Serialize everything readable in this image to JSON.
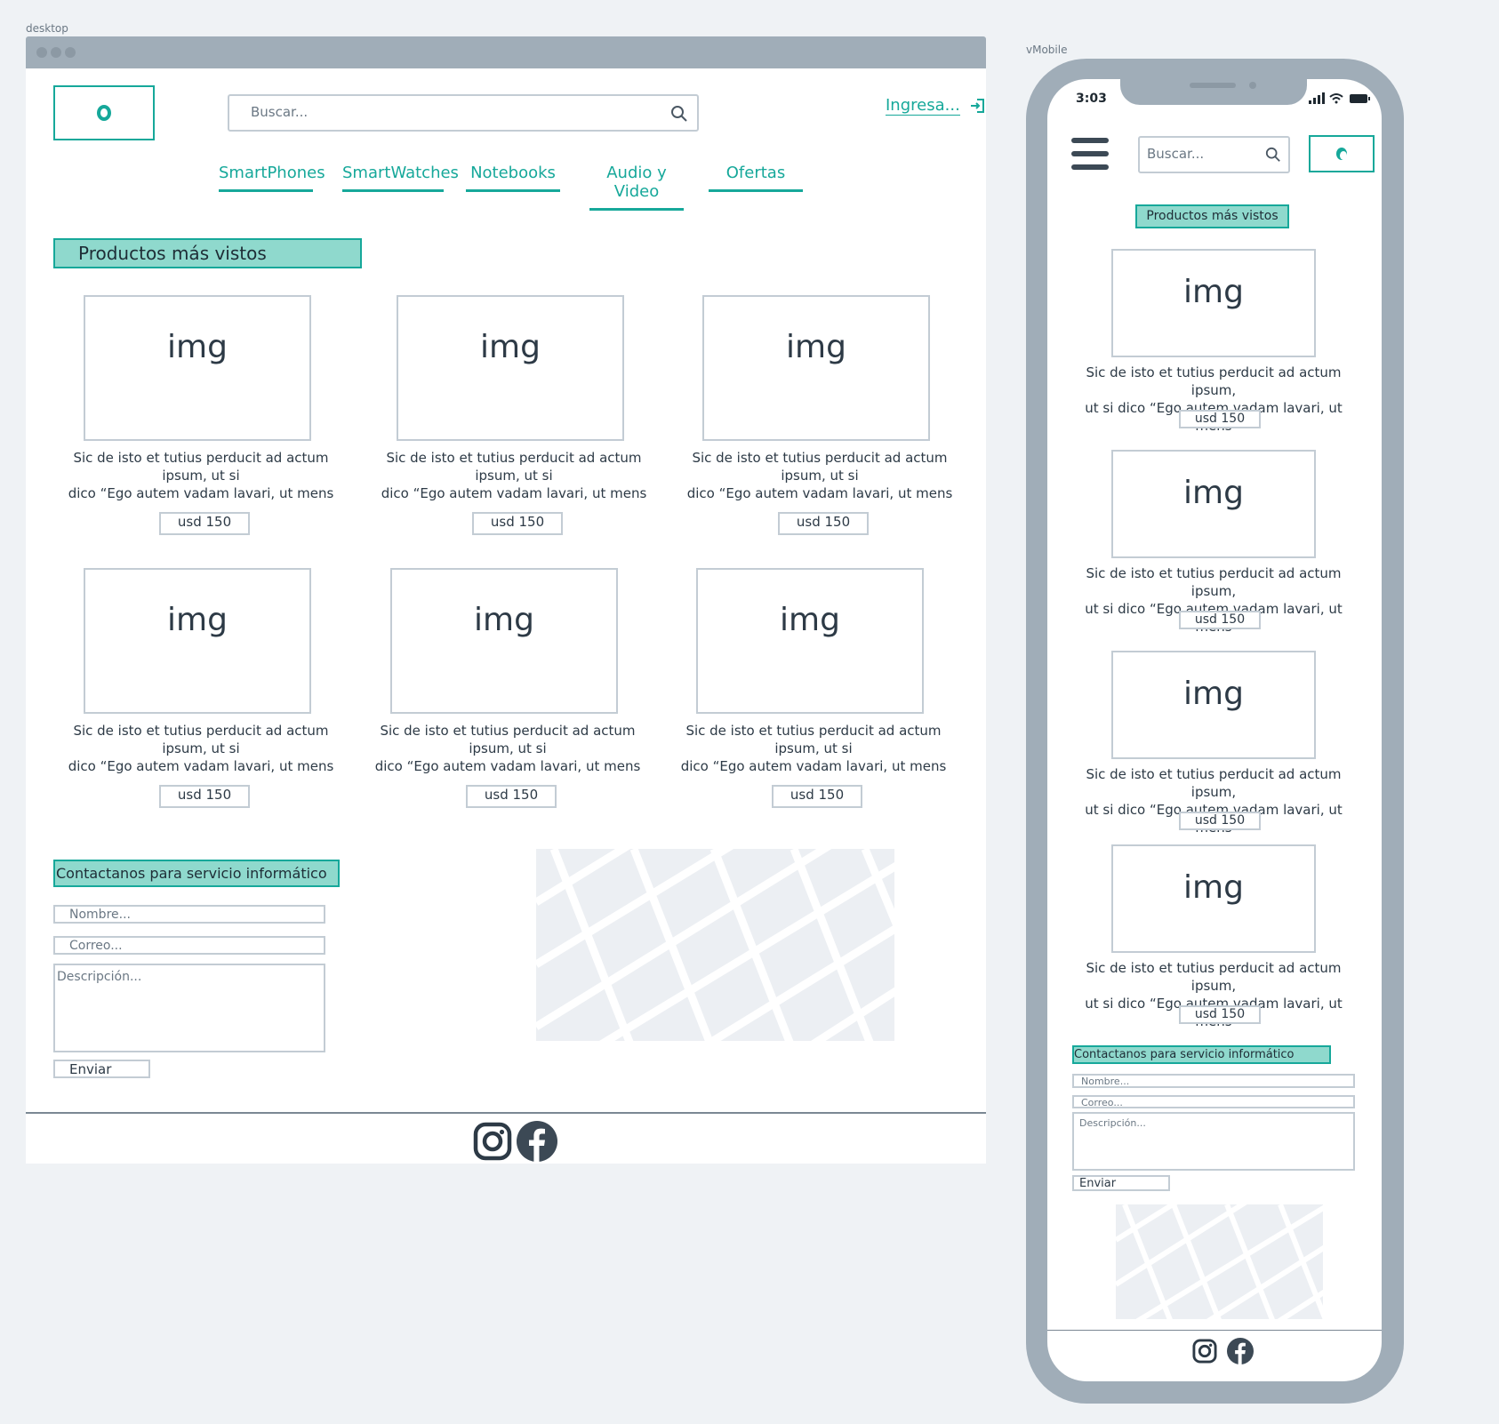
{
  "labels": {
    "desktop": "desktop",
    "mobile": "vMobile"
  },
  "header": {
    "search_placeholder": "Buscar...",
    "login": "Ingresa..."
  },
  "nav": [
    "SmartPhones",
    "SmartWatches",
    "Notebooks",
    "Audio y Video",
    "Ofertas"
  ],
  "products": {
    "title": "Productos más vistos",
    "img_label": "img",
    "desc_line1": "Sic de isto et tutius perducit ad actum ipsum, ut si",
    "desc_line2": "dico “Ego autem vadam lavari, ut mens",
    "mobile_line1": "Sic de isto et tutius perducit ad actum ipsum,",
    "mobile_line2": "ut si dico “Ego autem vadam lavari, ut mens",
    "price": "usd 150"
  },
  "contact": {
    "title": "Contactanos para servicio informático",
    "name_placeholder": "Nombre...",
    "email_placeholder": "Correo...",
    "description_placeholder": "Descripción...",
    "submit": "Enviar"
  },
  "mobile": {
    "time": "3:03"
  },
  "icons": {
    "brand": "logo-icon",
    "search": "search-icon",
    "login": "login-icon",
    "menu": "hamburger-menu-icon",
    "instagram": "instagram-icon",
    "facebook": "facebook-icon"
  },
  "colors": {
    "accent": "#16a89a",
    "accent_fill": "#8fd9cd",
    "frame": "#a0adb8",
    "border": "#c3ccd4"
  }
}
